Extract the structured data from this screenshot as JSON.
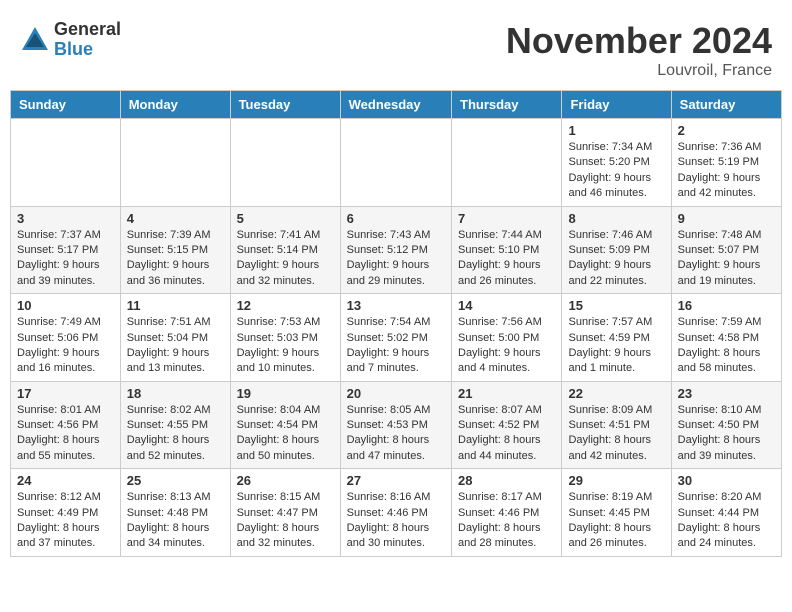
{
  "header": {
    "logo_general": "General",
    "logo_blue": "Blue",
    "month_title": "November 2024",
    "location": "Louvroil, France"
  },
  "weekdays": [
    "Sunday",
    "Monday",
    "Tuesday",
    "Wednesday",
    "Thursday",
    "Friday",
    "Saturday"
  ],
  "weeks": [
    [
      {
        "day": "",
        "info": ""
      },
      {
        "day": "",
        "info": ""
      },
      {
        "day": "",
        "info": ""
      },
      {
        "day": "",
        "info": ""
      },
      {
        "day": "",
        "info": ""
      },
      {
        "day": "1",
        "info": "Sunrise: 7:34 AM\nSunset: 5:20 PM\nDaylight: 9 hours and 46 minutes."
      },
      {
        "day": "2",
        "info": "Sunrise: 7:36 AM\nSunset: 5:19 PM\nDaylight: 9 hours and 42 minutes."
      }
    ],
    [
      {
        "day": "3",
        "info": "Sunrise: 7:37 AM\nSunset: 5:17 PM\nDaylight: 9 hours and 39 minutes."
      },
      {
        "day": "4",
        "info": "Sunrise: 7:39 AM\nSunset: 5:15 PM\nDaylight: 9 hours and 36 minutes."
      },
      {
        "day": "5",
        "info": "Sunrise: 7:41 AM\nSunset: 5:14 PM\nDaylight: 9 hours and 32 minutes."
      },
      {
        "day": "6",
        "info": "Sunrise: 7:43 AM\nSunset: 5:12 PM\nDaylight: 9 hours and 29 minutes."
      },
      {
        "day": "7",
        "info": "Sunrise: 7:44 AM\nSunset: 5:10 PM\nDaylight: 9 hours and 26 minutes."
      },
      {
        "day": "8",
        "info": "Sunrise: 7:46 AM\nSunset: 5:09 PM\nDaylight: 9 hours and 22 minutes."
      },
      {
        "day": "9",
        "info": "Sunrise: 7:48 AM\nSunset: 5:07 PM\nDaylight: 9 hours and 19 minutes."
      }
    ],
    [
      {
        "day": "10",
        "info": "Sunrise: 7:49 AM\nSunset: 5:06 PM\nDaylight: 9 hours and 16 minutes."
      },
      {
        "day": "11",
        "info": "Sunrise: 7:51 AM\nSunset: 5:04 PM\nDaylight: 9 hours and 13 minutes."
      },
      {
        "day": "12",
        "info": "Sunrise: 7:53 AM\nSunset: 5:03 PM\nDaylight: 9 hours and 10 minutes."
      },
      {
        "day": "13",
        "info": "Sunrise: 7:54 AM\nSunset: 5:02 PM\nDaylight: 9 hours and 7 minutes."
      },
      {
        "day": "14",
        "info": "Sunrise: 7:56 AM\nSunset: 5:00 PM\nDaylight: 9 hours and 4 minutes."
      },
      {
        "day": "15",
        "info": "Sunrise: 7:57 AM\nSunset: 4:59 PM\nDaylight: 9 hours and 1 minute."
      },
      {
        "day": "16",
        "info": "Sunrise: 7:59 AM\nSunset: 4:58 PM\nDaylight: 8 hours and 58 minutes."
      }
    ],
    [
      {
        "day": "17",
        "info": "Sunrise: 8:01 AM\nSunset: 4:56 PM\nDaylight: 8 hours and 55 minutes."
      },
      {
        "day": "18",
        "info": "Sunrise: 8:02 AM\nSunset: 4:55 PM\nDaylight: 8 hours and 52 minutes."
      },
      {
        "day": "19",
        "info": "Sunrise: 8:04 AM\nSunset: 4:54 PM\nDaylight: 8 hours and 50 minutes."
      },
      {
        "day": "20",
        "info": "Sunrise: 8:05 AM\nSunset: 4:53 PM\nDaylight: 8 hours and 47 minutes."
      },
      {
        "day": "21",
        "info": "Sunrise: 8:07 AM\nSunset: 4:52 PM\nDaylight: 8 hours and 44 minutes."
      },
      {
        "day": "22",
        "info": "Sunrise: 8:09 AM\nSunset: 4:51 PM\nDaylight: 8 hours and 42 minutes."
      },
      {
        "day": "23",
        "info": "Sunrise: 8:10 AM\nSunset: 4:50 PM\nDaylight: 8 hours and 39 minutes."
      }
    ],
    [
      {
        "day": "24",
        "info": "Sunrise: 8:12 AM\nSunset: 4:49 PM\nDaylight: 8 hours and 37 minutes."
      },
      {
        "day": "25",
        "info": "Sunrise: 8:13 AM\nSunset: 4:48 PM\nDaylight: 8 hours and 34 minutes."
      },
      {
        "day": "26",
        "info": "Sunrise: 8:15 AM\nSunset: 4:47 PM\nDaylight: 8 hours and 32 minutes."
      },
      {
        "day": "27",
        "info": "Sunrise: 8:16 AM\nSunset: 4:46 PM\nDaylight: 8 hours and 30 minutes."
      },
      {
        "day": "28",
        "info": "Sunrise: 8:17 AM\nSunset: 4:46 PM\nDaylight: 8 hours and 28 minutes."
      },
      {
        "day": "29",
        "info": "Sunrise: 8:19 AM\nSunset: 4:45 PM\nDaylight: 8 hours and 26 minutes."
      },
      {
        "day": "30",
        "info": "Sunrise: 8:20 AM\nSunset: 4:44 PM\nDaylight: 8 hours and 24 minutes."
      }
    ]
  ]
}
